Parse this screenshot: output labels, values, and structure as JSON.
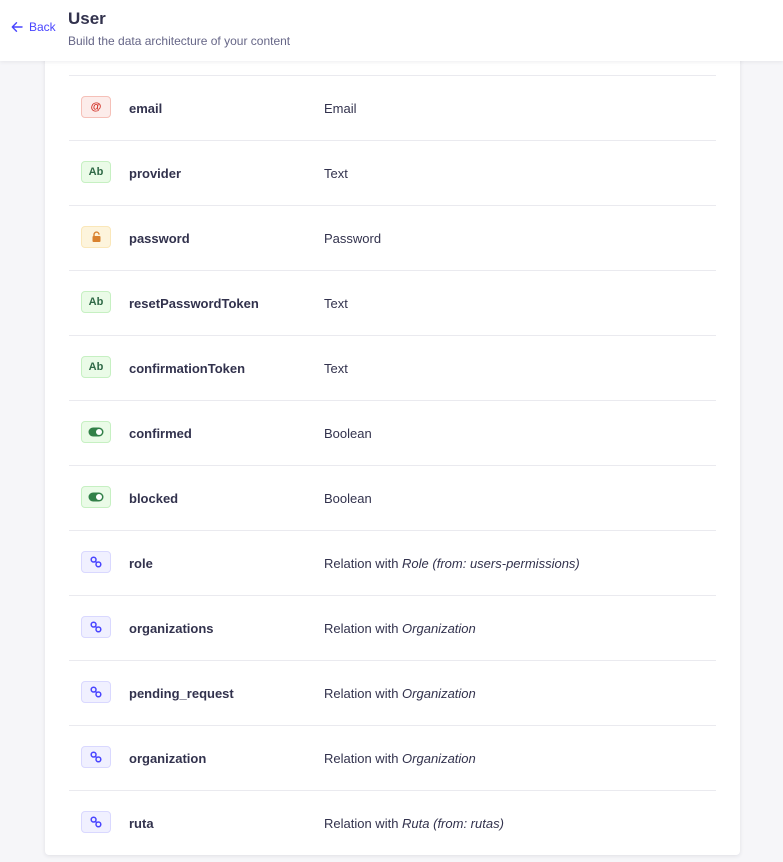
{
  "header": {
    "back_label": "Back",
    "title": "User",
    "subtitle": "Build the data architecture of your content"
  },
  "fields": [
    {
      "name": "email",
      "icon": "at-icon",
      "icon_class": "icon-email",
      "type_label": "Email",
      "target": ""
    },
    {
      "name": "provider",
      "icon": "text-icon",
      "icon_class": "icon-text",
      "type_label": "Text",
      "target": ""
    },
    {
      "name": "password",
      "icon": "lock-icon",
      "icon_class": "icon-password",
      "type_label": "Password",
      "target": ""
    },
    {
      "name": "resetPasswordToken",
      "icon": "text-icon",
      "icon_class": "icon-text",
      "type_label": "Text",
      "target": ""
    },
    {
      "name": "confirmationToken",
      "icon": "text-icon",
      "icon_class": "icon-text",
      "type_label": "Text",
      "target": ""
    },
    {
      "name": "confirmed",
      "icon": "toggle-icon",
      "icon_class": "icon-boolean",
      "type_label": "Boolean",
      "target": ""
    },
    {
      "name": "blocked",
      "icon": "toggle-icon",
      "icon_class": "icon-boolean",
      "type_label": "Boolean",
      "target": ""
    },
    {
      "name": "role",
      "icon": "link-icon",
      "icon_class": "icon-relation",
      "type_label": "Relation with ",
      "target": "Role (from: users-permissions)"
    },
    {
      "name": "organizations",
      "icon": "link-icon",
      "icon_class": "icon-relation",
      "type_label": "Relation with ",
      "target": "Organization"
    },
    {
      "name": "pending_request",
      "icon": "link-icon",
      "icon_class": "icon-relation",
      "type_label": "Relation with ",
      "target": "Organization"
    },
    {
      "name": "organization",
      "icon": "link-icon",
      "icon_class": "icon-relation",
      "type_label": "Relation with ",
      "target": "Organization"
    },
    {
      "name": "ruta",
      "icon": "link-icon",
      "icon_class": "icon-relation",
      "type_label": "Relation with ",
      "target": "Ruta (from: rutas)"
    }
  ],
  "icon_glyphs": {
    "at-icon": "@",
    "text-icon": "Ab"
  },
  "colors": {
    "accent": "#4945ff",
    "text": "#32324d",
    "subtle_text": "#666687",
    "background": "#f6f6f9"
  }
}
